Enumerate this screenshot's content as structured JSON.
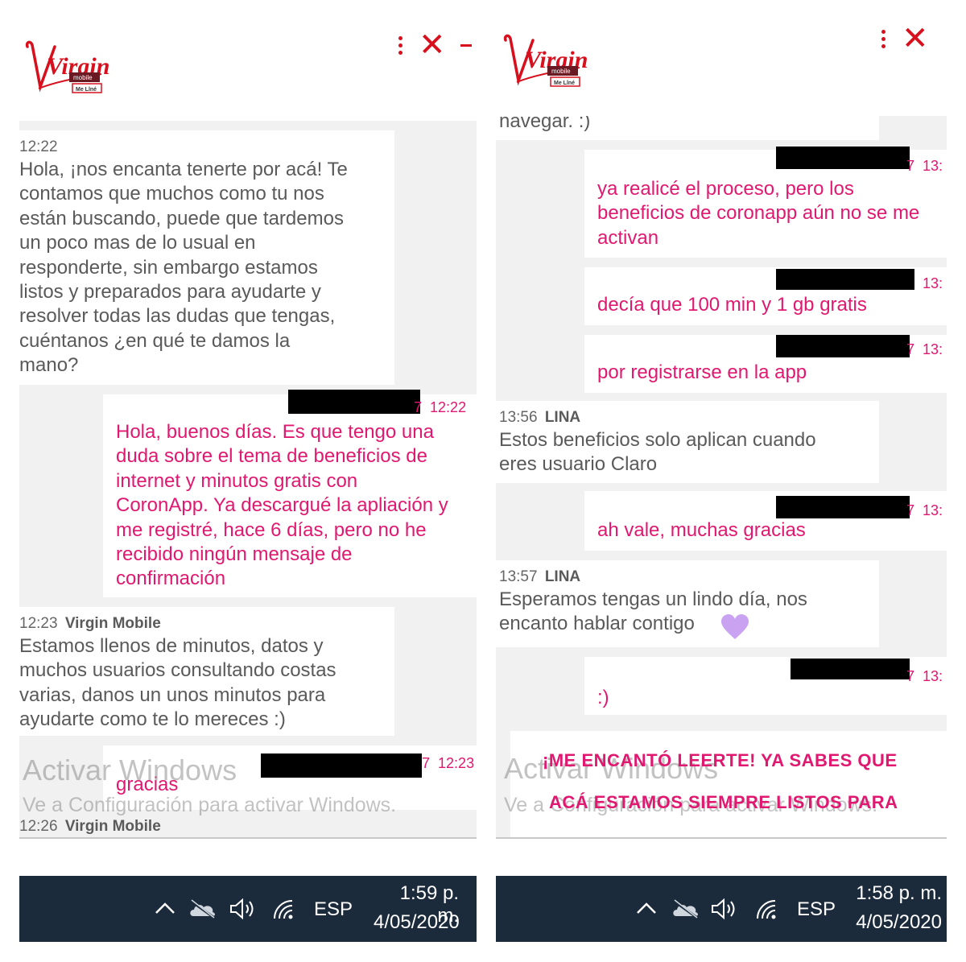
{
  "brand": {
    "logo_text": "Virgin",
    "logo_sub1": "mobile",
    "logo_sub2": "Me Llné"
  },
  "left": {
    "partial_bottom_meta": {
      "time": "12:26",
      "sender": "Virgin Mobile"
    },
    "messages": [
      {
        "side": "agent",
        "time": "12:22",
        "sender": "",
        "lines": [
          "Hola, ¡nos encanta tenerte por acá! Te",
          "contamos que muchos como tu nos",
          "están buscando, puede que tardemos",
          "un poco mas de lo usual en",
          "responderte, sin embargo estamos",
          "listos y preparados para ayudarte y",
          "resolver todas las dudas que tengas,",
          "cuéntanos ¿en qué te damos la",
          "mano?"
        ]
      },
      {
        "side": "user",
        "time": "12:22",
        "id_tail": "7",
        "lines": [
          "Hola, buenos días. Es que tengo una",
          "duda sobre el tema de beneficios de",
          "internet y minutos gratis con",
          "CoronApp. Ya descargué la apliación y",
          "me registré, hace 6 días, pero no he",
          "recibido ningún mensaje de",
          "confirmación"
        ]
      },
      {
        "side": "agent",
        "time": "12:23",
        "sender": "Virgin Mobile",
        "lines": [
          "Estamos llenos de minutos, datos y",
          "muchos usuarios consultando costas",
          "varias, danos un unos minutos para",
          "ayudarte como te lo mereces :)"
        ]
      },
      {
        "side": "user",
        "time": "12:23",
        "id_tail": "7",
        "lines": [
          "gracias"
        ]
      }
    ],
    "taskbar": {
      "lang": "ESP",
      "time": "1:59 p. m.",
      "date": "4/05/2020"
    }
  },
  "right": {
    "partial_top_text": "navegar. :)",
    "messages": [
      {
        "side": "user",
        "time": "13:",
        "id_tail": "7",
        "lines": [
          "ya realicé el proceso, pero los",
          "beneficios de coronapp aún no se me",
          "activan"
        ]
      },
      {
        "side": "user",
        "time": "13:",
        "id_tail": "",
        "lines": [
          "decía que 100 min y 1 gb gratis"
        ]
      },
      {
        "side": "user",
        "time": "13:",
        "id_tail": "7",
        "lines": [
          "por registrarse en la app"
        ]
      },
      {
        "side": "agent",
        "time": "13:56",
        "sender": "LINA",
        "lines": [
          "Estos beneficios solo aplican cuando",
          "eres usuario Claro"
        ]
      },
      {
        "side": "user",
        "time": "13:",
        "id_tail": "7",
        "lines": [
          "ah vale, muchas gracias"
        ]
      },
      {
        "side": "agent",
        "time": "13:57",
        "sender": "LINA",
        "lines": [
          "Esperamos tengas un lindo día, nos",
          "encanto hablar contigo"
        ]
      },
      {
        "side": "user",
        "time": "13:",
        "id_tail": "7",
        "lines": [
          ":)"
        ]
      }
    ],
    "closing_lines": [
      "¡ME ENCANTÓ LEERTE!  YA SABES QUE",
      "ACÁ ESTAMOS SIEMPRE LISTOS PARA"
    ],
    "taskbar": {
      "lang": "ESP",
      "time": "1:58 p. m.",
      "date": "4/05/2020"
    }
  },
  "watermark": {
    "title": "Activar Windows",
    "subtitle": "Ve a Configuración para activar Windows."
  },
  "colors": {
    "brand_red": "#d8101e",
    "user_text": "#e0186f",
    "agent_text": "#5a5a5a",
    "chat_bg": "#f1f1f1",
    "taskbar": "#1c2b3b",
    "heart": "#c9a3f2"
  },
  "icons": [
    "more-vert-icon",
    "close-icon",
    "minimize-icon",
    "chevron-up-icon",
    "onedrive-icon",
    "volume-icon",
    "wifi-icon",
    "heart-icon"
  ]
}
